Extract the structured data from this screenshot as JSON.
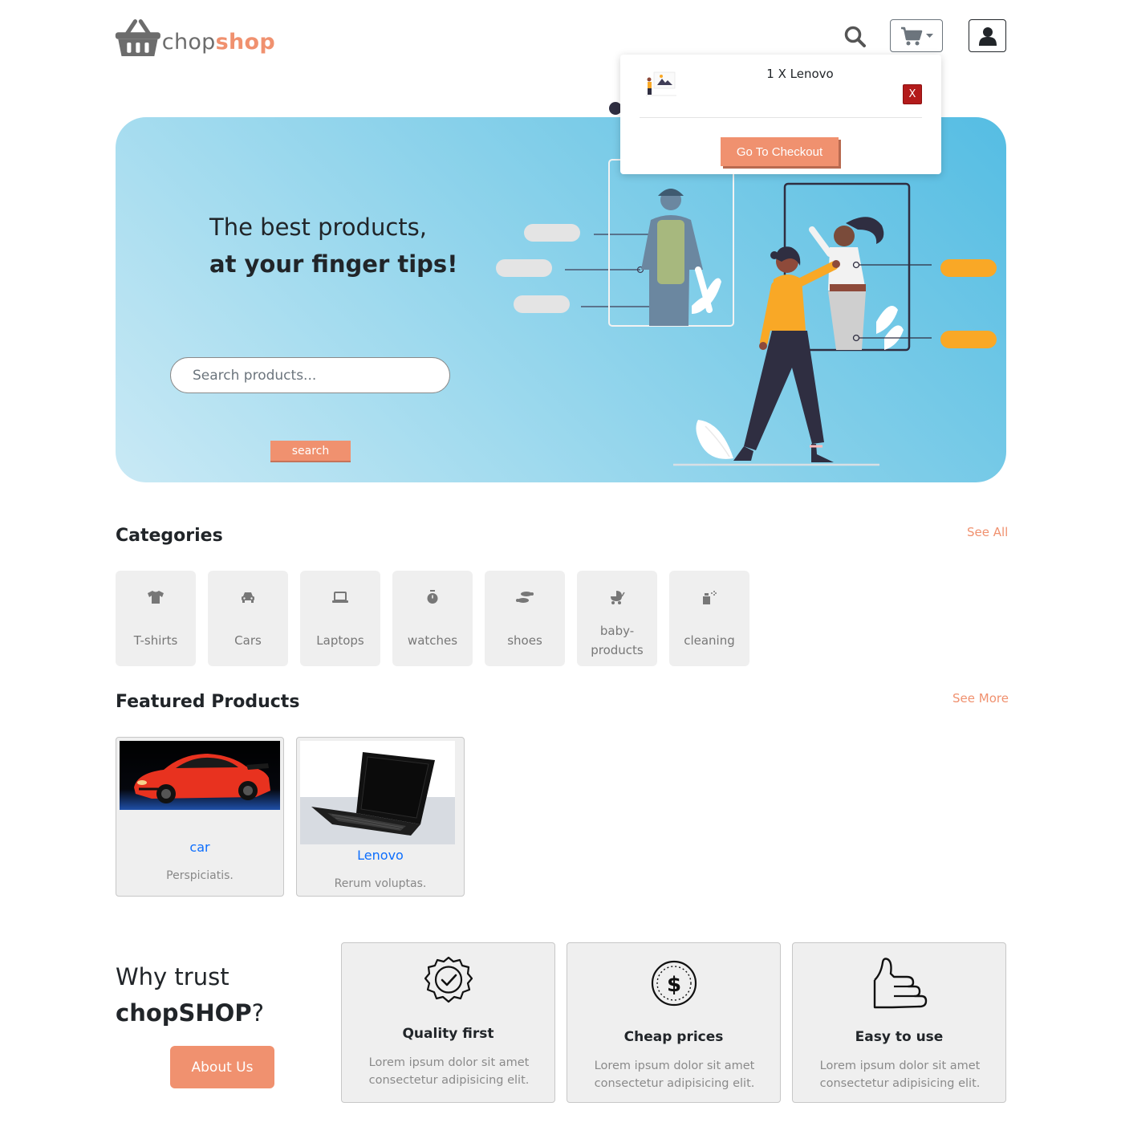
{
  "header": {
    "logo_part1": "chop",
    "logo_part2": "shop",
    "icons": [
      "basket-logo-icon",
      "search-icon",
      "cart-icon",
      "caret-down-icon",
      "user-icon"
    ]
  },
  "cart": {
    "item_text": "1 X Lenovo",
    "remove_label": "X",
    "checkout_label": "Go To Checkout"
  },
  "hero": {
    "line1": "The best products,",
    "line2": "at your finger tips!",
    "search_placeholder": "Search products...",
    "search_button": "search"
  },
  "categories": {
    "title": "Categories",
    "see_all": "See All",
    "items": [
      {
        "label": "T-shirts",
        "icon": "tshirt-icon"
      },
      {
        "label": "Cars",
        "icon": "car-icon"
      },
      {
        "label": "Laptops",
        "icon": "laptop-icon"
      },
      {
        "label": "watches",
        "icon": "stopwatch-icon"
      },
      {
        "label": "shoes",
        "icon": "shoe-prints-icon"
      },
      {
        "label": "baby-products",
        "icon": "baby-carriage-icon"
      },
      {
        "label": "cleaning",
        "icon": "spray-bottle-icon"
      }
    ]
  },
  "featured": {
    "title": "Featured Products",
    "see_more": "See More",
    "items": [
      {
        "title": "car",
        "desc": "Perspiciatis."
      },
      {
        "title": "Lenovo",
        "desc": "Rerum voluptas."
      }
    ]
  },
  "trust": {
    "line1": "Why trust",
    "brand": "chopSHOP",
    "suffix": "?",
    "about_button": "About Us",
    "features": [
      {
        "title": "Quality first",
        "text": "Lorem ipsum dolor sit amet consectetur adipisicing elit.",
        "icon": "quality-badge-icon"
      },
      {
        "title": "Cheap prices",
        "text": "Lorem ipsum dolor sit amet consectetur adipisicing elit.",
        "icon": "dollar-coin-icon"
      },
      {
        "title": "Easy to use",
        "text": "Lorem ipsum dolor sit amet consectetur adipisicing elit.",
        "icon": "thumbs-up-icon"
      }
    ]
  },
  "colors": {
    "accent": "#f0916f",
    "link": "#0d6efd",
    "danger": "#b31b1b",
    "card_bg": "#efefef"
  }
}
